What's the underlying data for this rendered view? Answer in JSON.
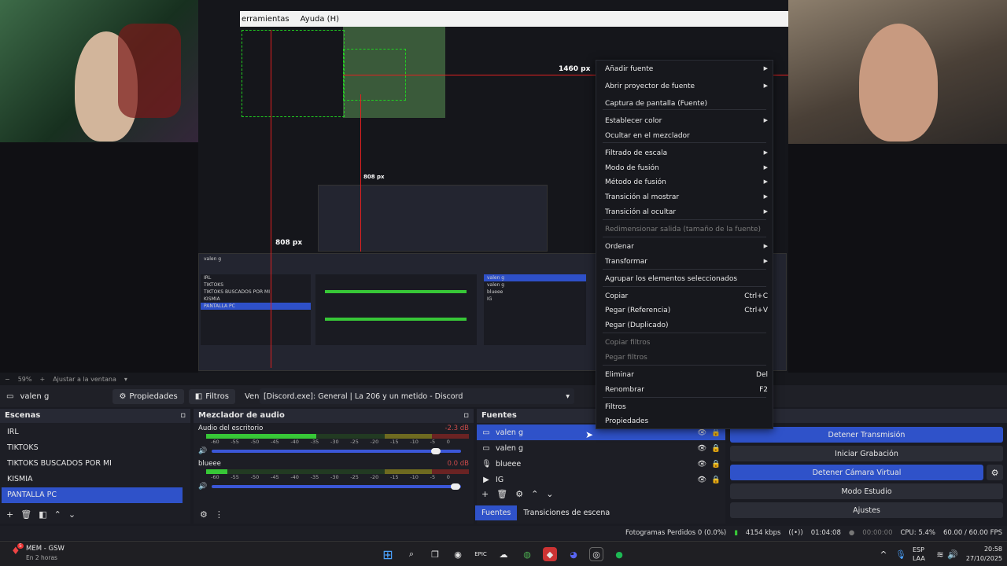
{
  "preview": {
    "nested_menu": [
      "erramientas",
      "Ayuda (H)"
    ],
    "label_width": "1460 px",
    "label_height_inner": "808 px",
    "label_height": "808 px",
    "zoom_level": "59%",
    "fit_label": "Ajustar a la ventana"
  },
  "source_toolbar": {
    "source_name": "valen g",
    "properties_label": "Propiedades",
    "filters_label": "Filtros",
    "window_label": "Ventana",
    "window_value": "[Discord.exe]: General | La 206 y un metido - Discord"
  },
  "scenes": {
    "title": "Escenas",
    "items": [
      "IRL",
      "TIKTOKS",
      "TIKTOKS BUSCADOS POR MI",
      "KISMIA",
      "PANTALLA PC"
    ],
    "selected": "PANTALLA PC"
  },
  "mixer": {
    "title": "Mezclador de audio",
    "channels": [
      {
        "name": "Audio del escritorio",
        "db": "-2.3 dB",
        "level": 0.42
      },
      {
        "name": "blueee",
        "db": "0.0 dB",
        "level": 0.08
      }
    ],
    "ticks": [
      "-60",
      "-55",
      "-50",
      "-45",
      "-40",
      "-35",
      "-30",
      "-25",
      "-20",
      "-15",
      "-10",
      "-5",
      "0"
    ]
  },
  "sources": {
    "title": "Fuentes",
    "items": [
      {
        "name": "valen g",
        "icon": "window-icon"
      },
      {
        "name": "valen g",
        "icon": "window-icon"
      },
      {
        "name": "blueee",
        "icon": "mic-icon"
      },
      {
        "name": "IG",
        "icon": "play-icon"
      }
    ],
    "tab_sources": "Fuentes",
    "tab_transitions": "Transiciones de escena"
  },
  "controls": {
    "stop_stream": "Detener Transmisión",
    "start_record": "Iniciar Grabación",
    "stop_virtual_cam": "Detener Cámara Virtual",
    "studio_mode": "Modo Estudio",
    "settings": "Ajustes"
  },
  "status": {
    "dropped_frames": "Fotogramas Perdidos 0 (0.0%)",
    "bitrate": "4154 kbps",
    "stream_time": "01:04:08",
    "record_time": "00:00:00",
    "cpu": "CPU: 5.4%",
    "fps": "60.00 / 60.00 FPS"
  },
  "taskbar": {
    "app_name": "MEM - GSW",
    "app_sub": "En 2 horas",
    "lang": "ESP",
    "lang_sub": "LAA",
    "time": "20:58",
    "date": "27/10/2025",
    "badge": "5"
  },
  "context_menu": {
    "items": [
      {
        "label": "Añadir fuente",
        "shortcut": "",
        "submenu": true,
        "disabled": false
      },
      {
        "label": "Abrir proyector de fuente",
        "shortcut": "",
        "submenu": true,
        "disabled": false
      },
      {
        "label": "Captura de pantalla (Fuente)",
        "shortcut": "",
        "submenu": false,
        "disabled": false
      },
      {
        "label": "Establecer color",
        "shortcut": "",
        "submenu": true,
        "disabled": false
      },
      {
        "label": "Ocultar en el mezclador",
        "shortcut": "",
        "submenu": false,
        "disabled": false
      },
      {
        "label": "Filtrado de escala",
        "shortcut": "",
        "submenu": true,
        "disabled": false
      },
      {
        "label": "Modo de fusión",
        "shortcut": "",
        "submenu": true,
        "disabled": false
      },
      {
        "label": "Método de fusión",
        "shortcut": "",
        "submenu": true,
        "disabled": false
      },
      {
        "label": "Transición al mostrar",
        "shortcut": "",
        "submenu": true,
        "disabled": false
      },
      {
        "label": "Transición al ocultar",
        "shortcut": "",
        "submenu": true,
        "disabled": false
      },
      {
        "label": "Redimensionar salida (tamaño de la fuente)",
        "shortcut": "",
        "submenu": false,
        "disabled": true
      },
      {
        "label": "Ordenar",
        "shortcut": "",
        "submenu": true,
        "disabled": false
      },
      {
        "label": "Transformar",
        "shortcut": "",
        "submenu": true,
        "disabled": false
      },
      {
        "label": "Agrupar los elementos seleccionados",
        "shortcut": "",
        "submenu": false,
        "disabled": false
      },
      {
        "label": "Copiar",
        "shortcut": "Ctrl+C",
        "submenu": false,
        "disabled": false
      },
      {
        "label": "Pegar (Referencia)",
        "shortcut": "Ctrl+V",
        "submenu": false,
        "disabled": false
      },
      {
        "label": "Pegar (Duplicado)",
        "shortcut": "",
        "submenu": false,
        "disabled": false
      },
      {
        "label": "Copiar filtros",
        "shortcut": "",
        "submenu": false,
        "disabled": true
      },
      {
        "label": "Pegar filtros",
        "shortcut": "",
        "submenu": false,
        "disabled": true
      },
      {
        "label": "Eliminar",
        "shortcut": "Del",
        "submenu": false,
        "disabled": false
      },
      {
        "label": "Renombrar",
        "shortcut": "F2",
        "submenu": false,
        "disabled": false
      },
      {
        "label": "Filtros",
        "shortcut": "",
        "submenu": false,
        "disabled": false
      },
      {
        "label": "Propiedades",
        "shortcut": "",
        "submenu": false,
        "disabled": false
      }
    ]
  },
  "colors": {
    "accent": "#2f52c9",
    "guide_red": "#e02020",
    "guide_green": "#21d021"
  }
}
